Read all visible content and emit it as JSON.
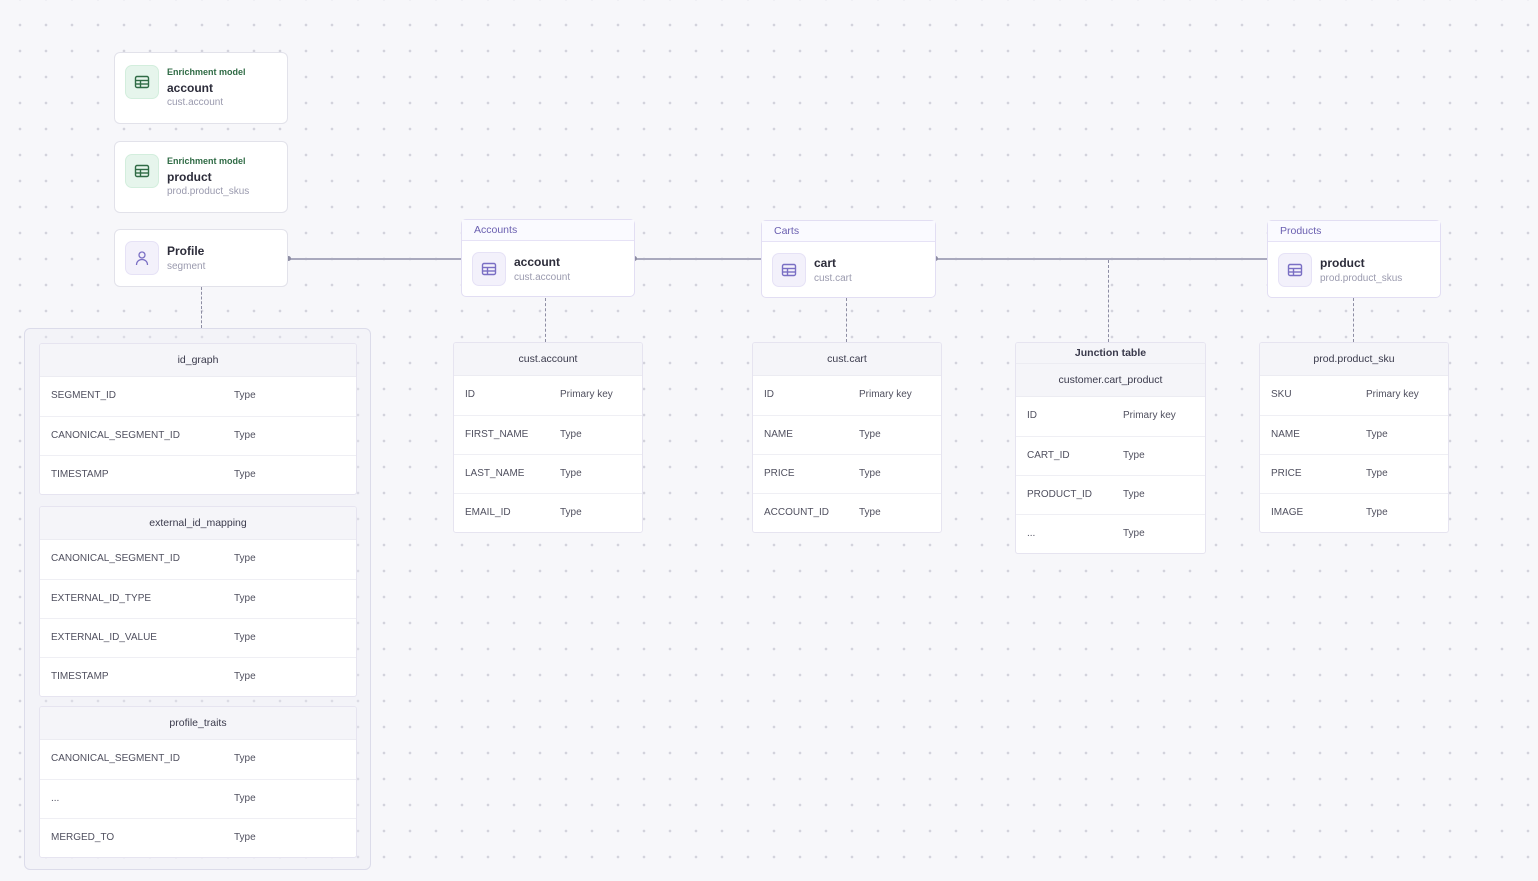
{
  "colors": {
    "accent": "#6a5fb0",
    "enrichment": "#2f6b45",
    "connector": "#a9a9bd"
  },
  "enrichment_models": [
    {
      "kind": "Enrichment model",
      "title": "account",
      "subtitle": "cust.account",
      "icon": "table-icon"
    },
    {
      "kind": "Enrichment model",
      "title": "product",
      "subtitle": "prod.product_skus",
      "icon": "table-icon"
    }
  ],
  "profile": {
    "title": "Profile",
    "subtitle": "segment",
    "icon": "user-icon"
  },
  "entities": [
    {
      "group": "Accounts",
      "title": "account",
      "subtitle": "cust.account",
      "icon": "table-icon"
    },
    {
      "group": "Carts",
      "title": "cart",
      "subtitle": "cust.cart",
      "icon": "table-icon"
    },
    {
      "group": "Products",
      "title": "product",
      "subtitle": "prod.product_skus",
      "icon": "table-icon"
    }
  ],
  "tables": [
    {
      "name": "id_graph",
      "rows": [
        [
          "SEGMENT_ID",
          "Type"
        ],
        [
          "CANONICAL_SEGMENT_ID",
          "Type"
        ],
        [
          "TIMESTAMP",
          "Type"
        ]
      ]
    },
    {
      "name": "external_id_mapping",
      "rows": [
        [
          "CANONICAL_SEGMENT_ID",
          "Type"
        ],
        [
          "EXTERNAL_ID_TYPE",
          "Type"
        ],
        [
          "EXTERNAL_ID_VALUE",
          "Type"
        ],
        [
          "TIMESTAMP",
          "Type"
        ]
      ]
    },
    {
      "name": "profile_traits",
      "rows": [
        [
          "CANONICAL_SEGMENT_ID",
          "Type"
        ],
        [
          "...",
          "Type"
        ],
        [
          "MERGED_TO",
          "Type"
        ]
      ]
    },
    {
      "name": "cust.account",
      "rows": [
        [
          "ID",
          "Primary key"
        ],
        [
          "FIRST_NAME",
          "Type"
        ],
        [
          "LAST_NAME",
          "Type"
        ],
        [
          "EMAIL_ID",
          "Type"
        ]
      ]
    },
    {
      "name": "cust.cart",
      "rows": [
        [
          "ID",
          "Primary key"
        ],
        [
          "NAME",
          "Type"
        ],
        [
          "PRICE",
          "Type"
        ],
        [
          "ACCOUNT_ID",
          "Type"
        ]
      ]
    },
    {
      "label": "Junction table",
      "name": "customer.cart_product",
      "rows": [
        [
          "ID",
          "Primary key"
        ],
        [
          "CART_ID",
          "Type"
        ],
        [
          "PRODUCT_ID",
          "Type"
        ],
        [
          "...",
          "Type"
        ]
      ]
    },
    {
      "name": "prod.product_sku",
      "rows": [
        [
          "SKU",
          "Primary key"
        ],
        [
          "NAME",
          "Type"
        ],
        [
          "PRICE",
          "Type"
        ],
        [
          "IMAGE",
          "Type"
        ]
      ]
    }
  ]
}
